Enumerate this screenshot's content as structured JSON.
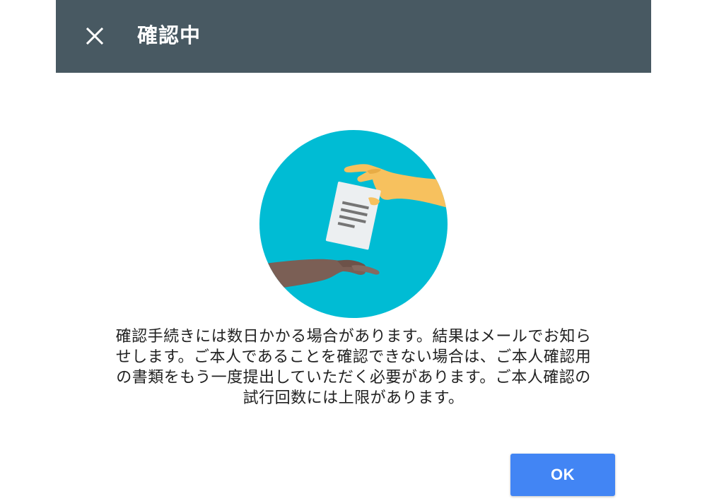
{
  "dialog": {
    "title": "確認中",
    "close_icon": "close-icon",
    "message_lines": [
      "確認手続きには数日かかる場合があります。結果はメールでお知ら",
      "せします。ご本人であることを確認できない場合は、ご本人確認用",
      "の書類をもう一度提出していただく必要があります。ご本人確認の",
      "試行回数には上限があります。"
    ],
    "ok_label": "OK"
  },
  "illustration": {
    "description_icon": "hand-over-document-icon"
  },
  "colors": {
    "appbar": "#485962",
    "accent": "#4285f4",
    "circle": "#00bcd4",
    "text": "#212121"
  }
}
